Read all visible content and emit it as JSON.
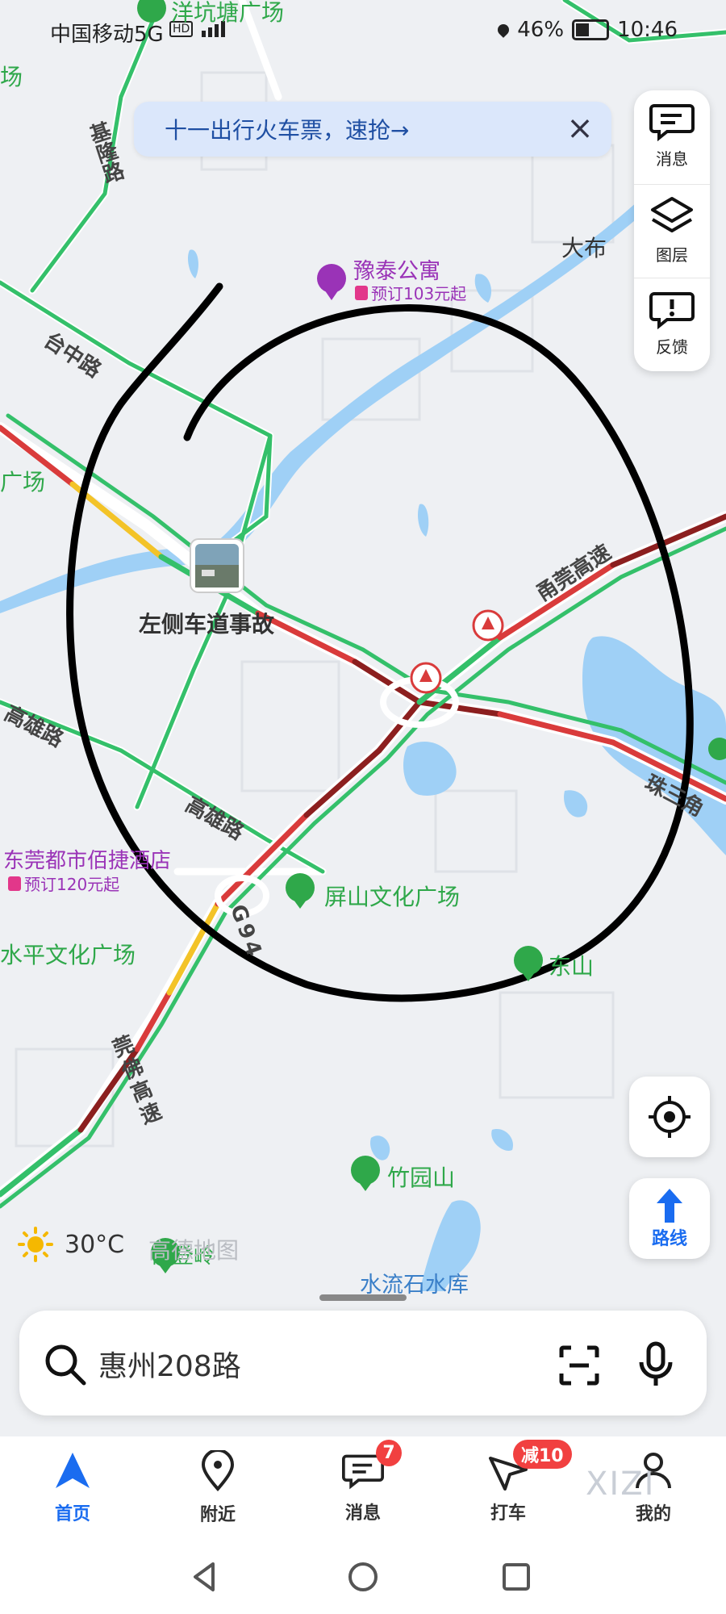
{
  "status_bar": {
    "carrier": "中国移动5G",
    "hd": "HD",
    "battery_percent": "46%",
    "time": "10:46"
  },
  "banner": {
    "text": "十一出行火车票，速抢→",
    "close_icon": "close-icon"
  },
  "toolbar": {
    "messages": "消息",
    "layers": "图层",
    "feedback": "反馈"
  },
  "map": {
    "pois": {
      "yangkengtang": "洋坑塘广场",
      "chang": "场",
      "yutai": "豫泰公寓",
      "yutai_price": "预订103元起",
      "dabu": "大布",
      "guangchang_left": "广场",
      "accident": "左侧车道事故",
      "dongguan_hotel": "东莞都市佰捷酒店",
      "dongguan_hotel_price": "预订120元起",
      "pingshan": "屏山文化广场",
      "shuiping": "水平文化广场",
      "dongshan": "东山",
      "zhuyuanshan": "竹园山",
      "shuiliushi": "水流石水库",
      "gaodeng": "高登岭"
    },
    "roads": {
      "jilong": "基隆路",
      "taizhong": "台中路",
      "gaoxiong_1": "高雄路",
      "gaoxiong_2": "高雄路",
      "yongguan": "甬莞高速",
      "zhusanjiao": "珠三角",
      "g94": "G94",
      "guanfo": "莞佛高速"
    },
    "logo": "高德地图",
    "colors": {
      "road_green": "#34c06a",
      "road_red": "#d93b3b",
      "road_darkred": "#8c1f1f",
      "road_yellow": "#f3c328",
      "water": "#9fd0f6",
      "circle": "#000000"
    }
  },
  "weather": {
    "icon": "sun-icon",
    "temp": "30°C"
  },
  "controls": {
    "locate_icon": "locate-icon",
    "route_label": "路线"
  },
  "search": {
    "placeholder": "惠州208路"
  },
  "tabs": [
    {
      "label": "首页",
      "icon": "home-arrow-icon",
      "active": true
    },
    {
      "label": "附近",
      "icon": "location-pin-icon",
      "active": false
    },
    {
      "label": "消息",
      "icon": "message-icon",
      "badge": "7",
      "active": false
    },
    {
      "label": "打车",
      "icon": "taxi-icon",
      "badge": "减10",
      "active": false
    },
    {
      "label": "我的",
      "icon": "user-icon",
      "active": false
    }
  ],
  "watermark": "XIZI"
}
